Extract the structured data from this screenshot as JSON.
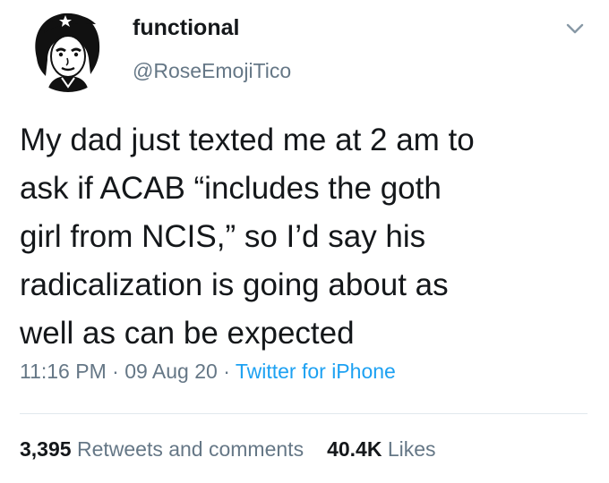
{
  "author": {
    "display_name": "functional",
    "handle": "@RoseEmojiTico",
    "avatar_icon": "portrait-avatar-icon"
  },
  "menu": {
    "icon": "chevron-down-icon"
  },
  "tweet": {
    "lines": [
      "My dad just texted me at 2 am to",
      "ask if ACAB “includes the goth",
      "girl from NCIS,” so I’d say his",
      "radicalization is going about as",
      "well as can be expected"
    ]
  },
  "meta": {
    "time": "11:16 PM",
    "separator": " · ",
    "date": "09 Aug 20",
    "source": "Twitter for iPhone"
  },
  "stats": {
    "retweets_count": "3,395",
    "retweets_label": "Retweets and comments",
    "likes_count": "40.4K",
    "likes_label": "Likes"
  },
  "colors": {
    "text": "#14171a",
    "secondary": "#657786",
    "link": "#1da1f2",
    "divider": "#e1e8ed"
  }
}
